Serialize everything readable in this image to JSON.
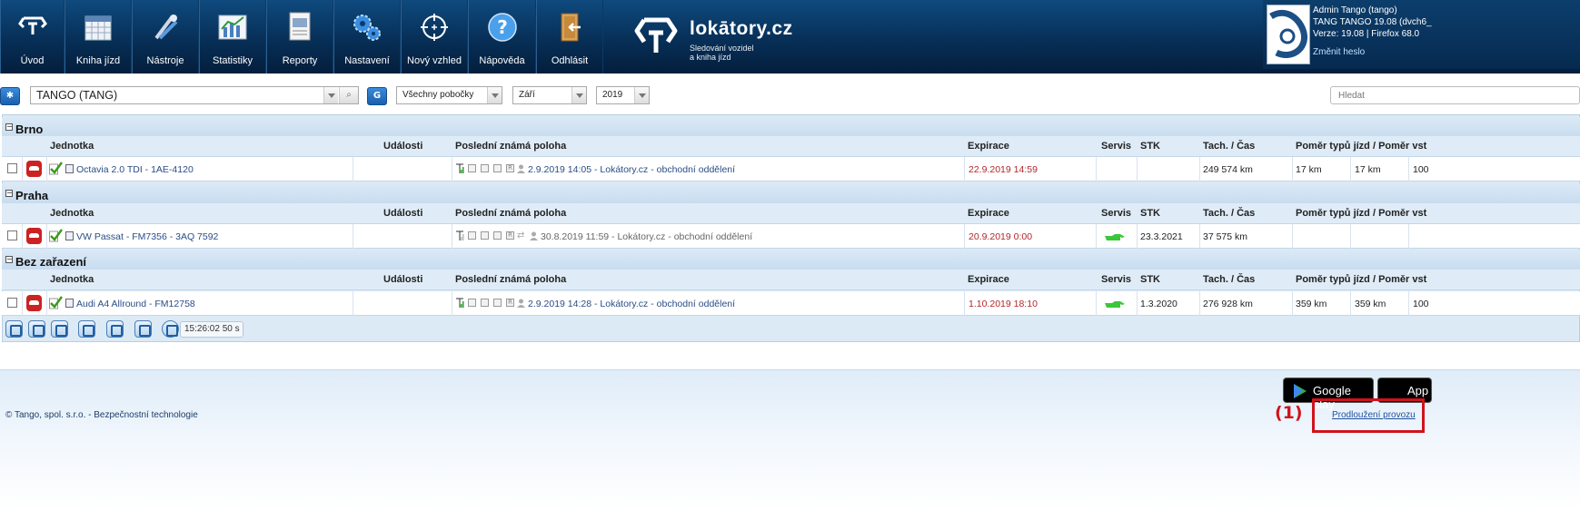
{
  "nav": {
    "items": [
      {
        "label": "Úvod",
        "icon": "tango-home-icon"
      },
      {
        "label": "Kniha jízd",
        "icon": "calendar-icon"
      },
      {
        "label": "Nástroje",
        "icon": "tools-icon"
      },
      {
        "label": "Statistiky",
        "icon": "statistics-icon"
      },
      {
        "label": "Reporty",
        "icon": "report-icon"
      },
      {
        "label": "Nastavení",
        "icon": "gears-icon"
      },
      {
        "label": "Nový vzhled",
        "icon": "crosshair-icon"
      },
      {
        "label": "Nápověda",
        "icon": "help-icon"
      },
      {
        "label": "Odhlásit",
        "icon": "logout-door-icon"
      }
    ]
  },
  "logo": {
    "brand": "lokātory.cz",
    "tagline_line1": "Sledování vozidel",
    "tagline_line2": "a kniha jízd"
  },
  "user": {
    "line1": "Admin Tango (tango)",
    "line2": "TANG TANGO 19.08 (dvch6_",
    "line3": "Verze: 19.08  |  Firefox 68.0",
    "change_password": "Změnit heslo"
  },
  "filters": {
    "company": "TANGO (TANG)",
    "group_button": "G",
    "branch": "Všechny pobočky",
    "month": "Září",
    "year": "2019",
    "search_placeholder": "Hledat"
  },
  "columns": {
    "unit": "Jednotka",
    "events": "Události",
    "last_position": "Poslední známá poloha",
    "expiration": "Expirace",
    "service": "Servis",
    "stk": "STK",
    "odometer": "Tach. / Čas",
    "ratio": "Poměr typů jízd / Poměr vst"
  },
  "groups": [
    {
      "name": "Brno",
      "vehicle": {
        "name": "Octavia 2.0 TDI - 1AE-4120",
        "events": "",
        "position": "2.9.2019 14:05 - Lokátory.cz - obchodní oddělení",
        "expiration": "22.9.2019 14:59",
        "service_oil": false,
        "stk": "",
        "odometer": "249 574 km",
        "ratio_a": "17 km",
        "ratio_b": "17 km",
        "ratio_c": "100"
      }
    },
    {
      "name": "Praha",
      "vehicle": {
        "name": "VW Passat - FM7356 - 3AQ 7592",
        "events": "",
        "position": "30.8.2019 11:59 - Lokátory.cz - obchodní oddělení",
        "expiration": "20.9.2019 0:00",
        "service_oil": true,
        "stk": "23.3.2021",
        "odometer": "37 575 km",
        "ratio_a": "",
        "ratio_b": "",
        "ratio_c": ""
      }
    },
    {
      "name": "Bez zařazení",
      "vehicle": {
        "name": "Audi A4 Allround - FM12758",
        "events": "",
        "position": "2.9.2019 14:28 - Lokátory.cz - obchodní oddělení",
        "expiration": "1.10.2019 18:10",
        "service_oil": true,
        "stk": "1.3.2020",
        "odometer": "276 928 km",
        "ratio_a": "359 km",
        "ratio_b": "359 km",
        "ratio_c": "100"
      }
    }
  ],
  "toolbar": {
    "timer": "15:26:02  50 s"
  },
  "footer": {
    "copyright": "© Tango, spol. s.r.o. - Bezpečnostní technologie",
    "google_play": "Google play",
    "app_store": "App",
    "renew_link": "Prodloužení provozu",
    "annotation_label": "(1)"
  },
  "colors": {
    "nav_bg": "#072f57",
    "accent": "#1a5fae",
    "expiry_red": "#b3262b",
    "annotation_red": "#d1121c"
  }
}
